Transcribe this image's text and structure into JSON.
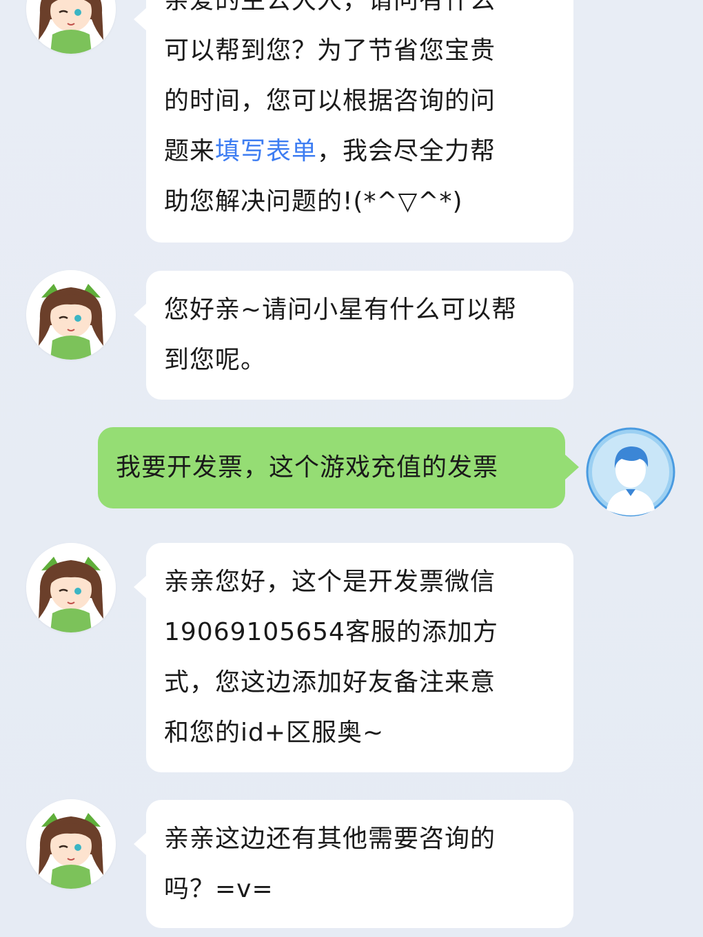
{
  "messages": [
    {
      "sender": "agent",
      "lines": [
        "亲爱的主公大人，请问有什么",
        "可以帮到您？为了节省您宝贵",
        "的时间，您可以根据咨询的问"
      ],
      "line4_before": "题来",
      "link_text": "填写表单",
      "line4_after": "，我会尽全力帮",
      "line5": "助您解决问题的!(*^▽^*)"
    },
    {
      "sender": "agent",
      "lines": [
        "您好亲~请问小星有什么可以帮",
        "到您呢。"
      ]
    },
    {
      "sender": "user",
      "text": "我要开发票，这个游戏充值的发票"
    },
    {
      "sender": "agent",
      "lines": [
        "亲亲您好，这个是开发票微信",
        "19069105654客服的添加方",
        "式，您这边添加好友备注来意",
        "和您的id+区服奥~"
      ]
    },
    {
      "sender": "agent",
      "lines": [
        "亲亲这边还有其他需要咨询的",
        "吗？=v="
      ]
    }
  ],
  "colors": {
    "background": "#e8edf5",
    "agent_bubble": "#ffffff",
    "user_bubble": "#95dd74",
    "link": "#3d7df2"
  },
  "icons": {
    "agent_avatar": "anime-girl-avatar-icon",
    "user_avatar": "user-silhouette-avatar-icon"
  }
}
